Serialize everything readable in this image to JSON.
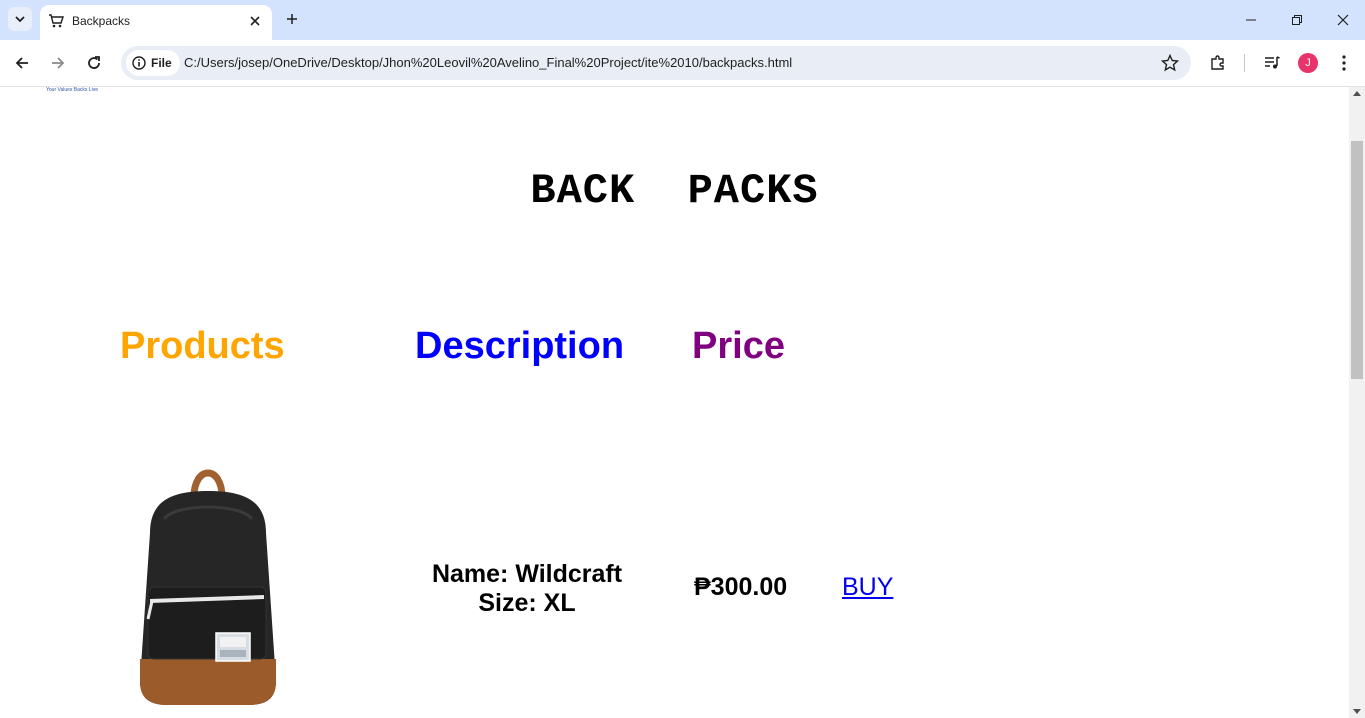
{
  "browser": {
    "tab_title": "Backpacks",
    "url_chip": "File",
    "url": "C:/Users/josep/OneDrive/Desktop/Jhon%20Leovil%20Avelino_Final%20Project/ite%2010/backpacks.html",
    "profile_initial": "J"
  },
  "page": {
    "logo_text": "Your Values Backs Live",
    "heading": "BACK  PACKS",
    "columns": {
      "products": "Products",
      "description": "Description",
      "price": "Price"
    },
    "column_colors": {
      "products": "#ffa500",
      "description": "#0000ff",
      "price": "#800080"
    },
    "items": [
      {
        "name_line": "Name: Wildcraft",
        "size_line": "Size: XL",
        "price": "₱300.00",
        "buy_label": "BUY"
      }
    ]
  }
}
